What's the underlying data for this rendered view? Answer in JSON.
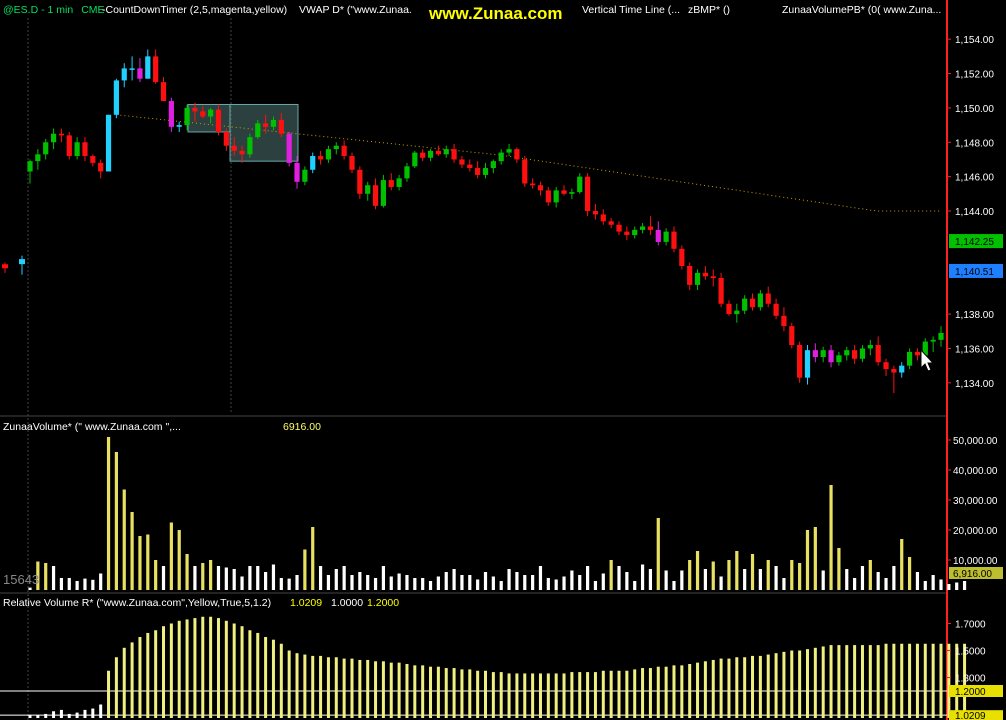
{
  "header": {
    "symbol": "@ES.D - 1 min",
    "exchange": "CME",
    "countdown": "-CountDownTimer (2,5,magenta,yellow)",
    "vwap": "VWAP D* (\"www.Zunaa.",
    "watermark": "www.Zunaa.com",
    "vtl": "Vertical Time Line (...",
    "zbmp": "zBMP* ()",
    "zvpb": "ZunaaVolumePB* (0( www.Zuna..."
  },
  "colors": {
    "background": "#000000",
    "up": "#00c000",
    "down": "#ff1010",
    "magenta": "#e020e0",
    "cyan": "#20d0ff",
    "vwap": "#c8a000",
    "volume_high": "#e8e060",
    "volume_normal": "#ffffff",
    "axis": "#ff2020",
    "rv": "#f0f080"
  },
  "price_panel": {
    "axis_ticks": [
      "1,154.00",
      "1,152.00",
      "1,150.00",
      "1,148.00",
      "1,146.00",
      "1,144.00",
      "1,140.51",
      "1,142.25",
      "1,138.00",
      "1,136.00",
      "1,134.00"
    ],
    "last_price": "1,142.25",
    "vwap_value": "1,140.51",
    "ylim": [
      1133.0,
      1155.0
    ]
  },
  "volume_panel": {
    "title": "ZunaaVolume* (\" www.Zunaa.com \",...",
    "value": "6916.00",
    "axis_ticks": [
      "50,000.00",
      "40,000.00",
      "30,000.00",
      "20,000.00",
      "10,000.00"
    ],
    "last_label": "6,916.00",
    "left_label": "15643"
  },
  "rv_panel": {
    "title": "Relative Volume R* (\"www.Zunaa.com\",Yellow,True,5,1.2)",
    "v1": "1.0209",
    "v2": "1.0000",
    "v3": "1.2000",
    "axis_ticks": [
      "1.7000",
      "1.5000",
      "1.3000",
      "1.2000",
      "1.0209"
    ]
  },
  "chart_data": {
    "type": "candlestick",
    "ohlc": [
      [
        1146.3,
        1147.0,
        1145.6,
        1146.9
      ],
      [
        1146.9,
        1147.6,
        1146.4,
        1147.3
      ],
      [
        1147.3,
        1148.2,
        1147.0,
        1148.0
      ],
      [
        1148.0,
        1148.8,
        1147.6,
        1148.5
      ],
      [
        1148.5,
        1148.8,
        1148.0,
        1148.4
      ],
      [
        1148.4,
        1148.6,
        1147.0,
        1147.2
      ],
      [
        1147.2,
        1148.3,
        1147.0,
        1148.0
      ],
      [
        1148.0,
        1148.3,
        1146.9,
        1147.2
      ],
      [
        1147.2,
        1147.3,
        1146.6,
        1146.8
      ],
      [
        1146.8,
        1147.0,
        1145.9,
        1146.3
      ],
      [
        1146.3,
        1149.6,
        1146.3,
        1149.6
      ],
      [
        1149.6,
        1151.7,
        1149.4,
        1151.6
      ],
      [
        1151.6,
        1152.6,
        1151.2,
        1152.3
      ],
      [
        1152.3,
        1153.0,
        1151.6,
        1152.3
      ],
      [
        1152.3,
        1152.9,
        1151.5,
        1151.7
      ],
      [
        1151.7,
        1153.4,
        1151.7,
        1153.0
      ],
      [
        1153.0,
        1153.4,
        1151.4,
        1151.5
      ],
      [
        1151.5,
        1151.8,
        1150.4,
        1150.4
      ],
      [
        1150.4,
        1150.6,
        1148.6,
        1148.9
      ],
      [
        1148.9,
        1149.2,
        1148.6,
        1149.0
      ],
      [
        1149.0,
        1150.2,
        1148.7,
        1150.0
      ],
      [
        1150.0,
        1150.3,
        1149.2,
        1149.8
      ],
      [
        1149.8,
        1150.1,
        1149.4,
        1149.5
      ],
      [
        1149.5,
        1150.0,
        1149.1,
        1149.9
      ],
      [
        1149.9,
        1150.2,
        1148.4,
        1148.6
      ],
      [
        1148.6,
        1148.8,
        1147.5,
        1147.8
      ],
      [
        1147.8,
        1148.3,
        1147.2,
        1147.5
      ],
      [
        1147.5,
        1147.8,
        1146.8,
        1147.3
      ],
      [
        1147.3,
        1148.5,
        1147.1,
        1148.3
      ],
      [
        1148.3,
        1149.3,
        1148.2,
        1149.1
      ],
      [
        1149.1,
        1149.6,
        1148.5,
        1148.9
      ],
      [
        1148.9,
        1149.5,
        1148.7,
        1149.3
      ],
      [
        1149.3,
        1149.7,
        1148.3,
        1148.5
      ],
      [
        1148.5,
        1148.6,
        1146.6,
        1146.8
      ],
      [
        1146.8,
        1147.2,
        1145.3,
        1145.7
      ],
      [
        1145.7,
        1146.6,
        1145.5,
        1146.4
      ],
      [
        1146.4,
        1147.4,
        1146.2,
        1147.2
      ],
      [
        1147.2,
        1147.5,
        1146.7,
        1147.0
      ],
      [
        1147.0,
        1147.8,
        1146.8,
        1147.6
      ],
      [
        1147.6,
        1148.0,
        1147.3,
        1147.8
      ],
      [
        1147.8,
        1148.1,
        1147.0,
        1147.2
      ],
      [
        1147.2,
        1147.4,
        1146.2,
        1146.4
      ],
      [
        1146.4,
        1146.6,
        1144.7,
        1145.0
      ],
      [
        1145.0,
        1145.7,
        1144.6,
        1145.5
      ],
      [
        1145.5,
        1145.9,
        1144.1,
        1144.3
      ],
      [
        1144.3,
        1146.1,
        1144.2,
        1145.8
      ],
      [
        1145.8,
        1146.2,
        1145.2,
        1145.4
      ],
      [
        1145.4,
        1146.1,
        1145.2,
        1145.9
      ],
      [
        1145.9,
        1146.8,
        1145.7,
        1146.6
      ],
      [
        1146.6,
        1147.5,
        1146.5,
        1147.4
      ],
      [
        1147.4,
        1147.6,
        1146.9,
        1147.1
      ],
      [
        1147.1,
        1147.6,
        1146.9,
        1147.5
      ],
      [
        1147.5,
        1147.8,
        1147.2,
        1147.3
      ],
      [
        1147.3,
        1147.8,
        1147.1,
        1147.6
      ],
      [
        1147.6,
        1147.9,
        1146.8,
        1147.0
      ],
      [
        1147.0,
        1147.2,
        1146.5,
        1146.7
      ],
      [
        1146.7,
        1147.0,
        1146.3,
        1146.5
      ],
      [
        1146.5,
        1146.9,
        1145.9,
        1146.1
      ],
      [
        1146.1,
        1146.8,
        1145.9,
        1146.5
      ],
      [
        1146.5,
        1147.0,
        1146.2,
        1146.9
      ],
      [
        1146.9,
        1147.6,
        1146.7,
        1147.4
      ],
      [
        1147.4,
        1147.9,
        1147.2,
        1147.6
      ],
      [
        1147.6,
        1147.7,
        1146.8,
        1147.0
      ],
      [
        1147.0,
        1147.2,
        1145.4,
        1145.6
      ],
      [
        1145.6,
        1145.9,
        1145.3,
        1145.5
      ],
      [
        1145.5,
        1145.7,
        1144.9,
        1145.2
      ],
      [
        1145.2,
        1145.4,
        1144.3,
        1144.5
      ],
      [
        1144.5,
        1145.4,
        1144.2,
        1145.2
      ],
      [
        1145.2,
        1145.5,
        1144.9,
        1145.0
      ],
      [
        1145.0,
        1145.3,
        1144.7,
        1145.1
      ],
      [
        1145.1,
        1146.2,
        1145.0,
        1146.0
      ],
      [
        1146.0,
        1146.2,
        1143.7,
        1144.0
      ],
      [
        1144.0,
        1144.4,
        1143.5,
        1143.8
      ],
      [
        1143.8,
        1144.1,
        1143.2,
        1143.4
      ],
      [
        1143.4,
        1143.6,
        1143.0,
        1143.2
      ],
      [
        1143.2,
        1143.4,
        1142.6,
        1142.8
      ],
      [
        1142.8,
        1143.1,
        1142.3,
        1142.6
      ],
      [
        1142.6,
        1143.1,
        1142.4,
        1142.9
      ],
      [
        1142.9,
        1143.3,
        1142.7,
        1143.1
      ],
      [
        1143.1,
        1143.7,
        1142.6,
        1142.9
      ],
      [
        1142.9,
        1143.4,
        1142.0,
        1142.2
      ],
      [
        1142.2,
        1143.0,
        1142.0,
        1142.8
      ],
      [
        1142.8,
        1143.1,
        1141.6,
        1141.8
      ],
      [
        1141.8,
        1142.0,
        1140.6,
        1140.8
      ],
      [
        1140.8,
        1141.0,
        1139.4,
        1139.7
      ],
      [
        1139.7,
        1140.6,
        1139.4,
        1140.4
      ],
      [
        1140.4,
        1140.8,
        1140.0,
        1140.2
      ],
      [
        1140.2,
        1140.6,
        1139.6,
        1140.1
      ],
      [
        1140.1,
        1140.4,
        1138.4,
        1138.6
      ],
      [
        1138.6,
        1138.8,
        1137.9,
        1138.0
      ],
      [
        1138.0,
        1138.6,
        1137.5,
        1138.2
      ],
      [
        1138.2,
        1139.1,
        1138.0,
        1138.9
      ],
      [
        1138.9,
        1139.2,
        1138.2,
        1138.4
      ],
      [
        1138.4,
        1139.4,
        1138.2,
        1139.2
      ],
      [
        1139.2,
        1139.6,
        1138.4,
        1138.6
      ],
      [
        1138.6,
        1138.9,
        1137.7,
        1137.9
      ],
      [
        1137.9,
        1138.4,
        1137.0,
        1137.3
      ],
      [
        1137.3,
        1137.5,
        1136.0,
        1136.2
      ],
      [
        1136.2,
        1136.4,
        1134.0,
        1134.3
      ],
      [
        1134.3,
        1136.2,
        1133.9,
        1135.9
      ],
      [
        1135.9,
        1136.3,
        1135.2,
        1135.5
      ],
      [
        1135.5,
        1136.1,
        1135.2,
        1135.9
      ],
      [
        1135.9,
        1136.2,
        1134.9,
        1135.2
      ],
      [
        1135.2,
        1135.8,
        1135.0,
        1135.6
      ],
      [
        1135.6,
        1136.1,
        1135.3,
        1135.9
      ],
      [
        1135.9,
        1136.2,
        1135.1,
        1135.4
      ],
      [
        1135.4,
        1136.2,
        1135.2,
        1136.0
      ],
      [
        1136.0,
        1136.5,
        1135.6,
        1136.2
      ],
      [
        1136.2,
        1136.7,
        1135.0,
        1135.2
      ],
      [
        1135.2,
        1135.4,
        1134.4,
        1134.8
      ],
      [
        1134.8,
        1135.0,
        1133.4,
        1134.6
      ],
      [
        1134.6,
        1135.2,
        1134.3,
        1135.0
      ],
      [
        1135.0,
        1136.0,
        1134.8,
        1135.8
      ],
      [
        1135.8,
        1136.0,
        1135.3,
        1135.6
      ],
      [
        1135.6,
        1136.6,
        1135.4,
        1136.4
      ],
      [
        1136.4,
        1136.7,
        1135.8,
        1136.5
      ],
      [
        1136.5,
        1137.3,
        1136.1,
        1136.9
      ]
    ],
    "volume": [
      800,
      9500,
      9000,
      8000,
      4000,
      4000,
      3000,
      3800,
      3400,
      5500,
      51000,
      46000,
      33500,
      26000,
      18000,
      18500,
      10000,
      8000,
      22500,
      20000,
      12000,
      8000,
      9000,
      10000,
      8000,
      7500,
      7000,
      4500,
      8000,
      8000,
      6000,
      8500,
      4000,
      3800,
      5000,
      13500,
      21000,
      8000,
      5000,
      7000,
      8000,
      5000,
      6000,
      5000,
      4000,
      8000,
      4500,
      5500,
      5000,
      4000,
      4000,
      3000,
      4500,
      6000,
      7000,
      5000,
      5000,
      3500,
      6000,
      4500,
      3000,
      7000,
      6000,
      5000,
      5000,
      8000,
      4000,
      3500,
      4500,
      6500,
      5000,
      8000,
      3000,
      5500,
      10000,
      8000,
      6000,
      3000,
      8500,
      7000,
      24000,
      6500,
      3000,
      6500,
      10000,
      13000,
      7000,
      9500,
      4500,
      10000,
      13000,
      7000,
      12000,
      7000,
      10000,
      8000,
      4000,
      10000,
      9000,
      20000,
      21000,
      6500,
      35000,
      14000,
      7000,
      4000,
      8000,
      10000,
      6000,
      4000,
      8000,
      17000,
      11000,
      6000,
      3000,
      5000,
      3500,
      2000,
      2500,
      3000
    ],
    "rel_volume": [
      1.02,
      1.02,
      1.03,
      1.05,
      1.06,
      1.03,
      1.04,
      1.06,
      1.07,
      1.1,
      1.35,
      1.45,
      1.52,
      1.56,
      1.6,
      1.63,
      1.65,
      1.68,
      1.7,
      1.72,
      1.73,
      1.74,
      1.75,
      1.75,
      1.74,
      1.72,
      1.7,
      1.68,
      1.65,
      1.63,
      1.6,
      1.58,
      1.55,
      1.5,
      1.48,
      1.47,
      1.46,
      1.46,
      1.45,
      1.45,
      1.44,
      1.44,
      1.43,
      1.43,
      1.42,
      1.42,
      1.41,
      1.41,
      1.4,
      1.39,
      1.39,
      1.38,
      1.38,
      1.37,
      1.37,
      1.36,
      1.36,
      1.35,
      1.35,
      1.34,
      1.34,
      1.33,
      1.33,
      1.33,
      1.33,
      1.33,
      1.33,
      1.33,
      1.33,
      1.34,
      1.34,
      1.34,
      1.34,
      1.35,
      1.35,
      1.35,
      1.35,
      1.36,
      1.37,
      1.37,
      1.38,
      1.38,
      1.39,
      1.39,
      1.4,
      1.41,
      1.42,
      1.43,
      1.44,
      1.44,
      1.45,
      1.45,
      1.46,
      1.46,
      1.47,
      1.48,
      1.49,
      1.5,
      1.5,
      1.51,
      1.52,
      1.53,
      1.54,
      1.54,
      1.54,
      1.54,
      1.54,
      1.54,
      1.54,
      1.55,
      1.55,
      1.55,
      1.55,
      1.55,
      1.55,
      1.55,
      1.55,
      1.55,
      1.55,
      1.55
    ]
  }
}
